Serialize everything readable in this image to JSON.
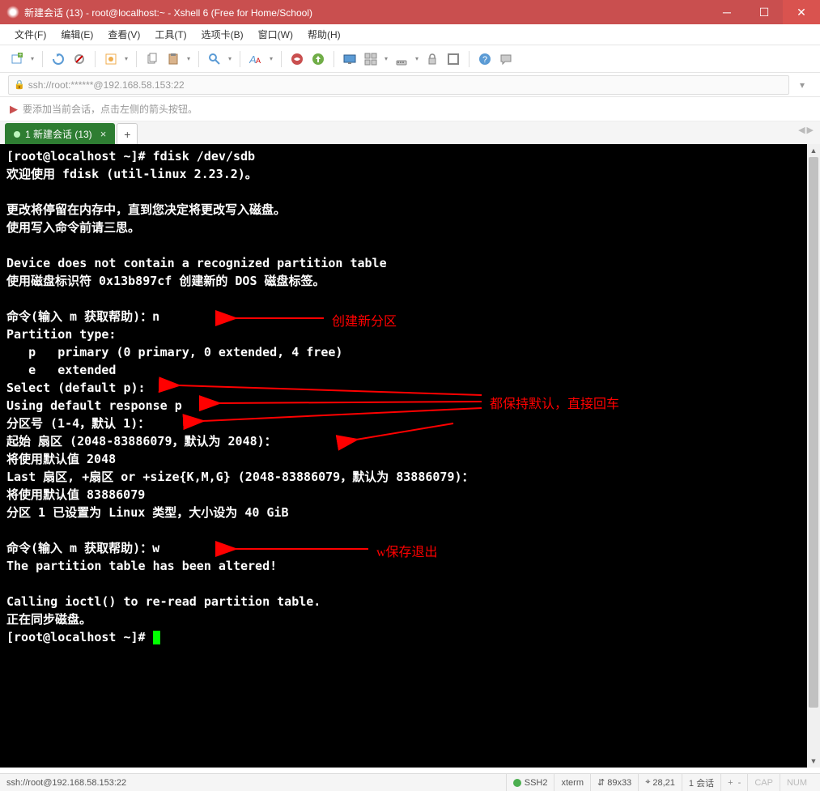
{
  "titlebar": {
    "title": "新建会话 (13) - root@localhost:~ - Xshell 6 (Free for Home/School)"
  },
  "menubar": {
    "file": "文件(F)",
    "edit": "编辑(E)",
    "view": "查看(V)",
    "tools": "工具(T)",
    "tabs": "选项卡(B)",
    "window": "窗口(W)",
    "help": "帮助(H)"
  },
  "addressbar": {
    "url": "ssh://root:******@192.168.58.153:22"
  },
  "hintbar": {
    "text": "要添加当前会话，点击左侧的箭头按钮。"
  },
  "tabs": {
    "active_label": "1 新建会话 (13)"
  },
  "terminal": {
    "lines": [
      "[root@localhost ~]# fdisk /dev/sdb",
      "欢迎使用 fdisk (util-linux 2.23.2)。",
      "",
      "更改将停留在内存中，直到您决定将更改写入磁盘。",
      "使用写入命令前请三思。",
      "",
      "Device does not contain a recognized partition table",
      "使用磁盘标识符 0x13b897cf 创建新的 DOS 磁盘标签。",
      "",
      "命令(输入 m 获取帮助)：n",
      "Partition type:",
      "   p   primary (0 primary, 0 extended, 4 free)",
      "   e   extended",
      "Select (default p):",
      "Using default response p",
      "分区号 (1-4，默认 1)：",
      "起始 扇区 (2048-83886079，默认为 2048)：",
      "将使用默认值 2048",
      "Last 扇区, +扇区 or +size{K,M,G} (2048-83886079，默认为 83886079)：",
      "将使用默认值 83886079",
      "分区 1 已设置为 Linux 类型，大小设为 40 GiB",
      "",
      "命令(输入 m 获取帮助)：w",
      "The partition table has been altered!",
      "",
      "Calling ioctl() to re-read partition table.",
      "正在同步磁盘。",
      "[root@localhost ~]# "
    ]
  },
  "annotations": {
    "a1": "创建新分区",
    "a2": "都保持默认，直接回车",
    "a3": "w保存退出"
  },
  "statusbar": {
    "left": "ssh://root@192.168.58.153:22",
    "proto": "SSH2",
    "term": "xterm",
    "size": "89x33",
    "pos": "28,21",
    "sessions": "1 会话",
    "cap": "CAP",
    "num": "NUM",
    "size_icon": "⇵",
    "pos_icon": "⌖"
  },
  "icons": {
    "minimize": "─",
    "maximize": "☐",
    "close": "✕",
    "lock": "🔒",
    "flag": "▶",
    "plus": "+",
    "x": "×",
    "up": "▲",
    "down": "▼",
    "left": "◀",
    "right": "▶",
    "dd": "▾"
  }
}
